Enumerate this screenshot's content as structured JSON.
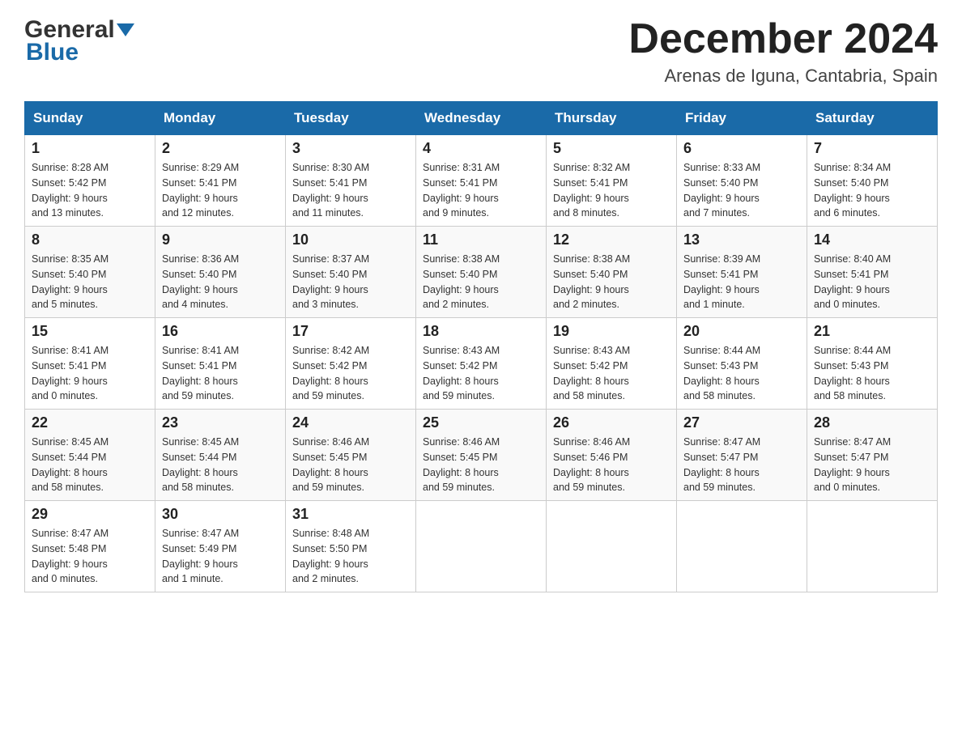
{
  "header": {
    "logo_general": "General",
    "logo_blue": "Blue",
    "month_title": "December 2024",
    "location": "Arenas de Iguna, Cantabria, Spain"
  },
  "days_of_week": [
    "Sunday",
    "Monday",
    "Tuesday",
    "Wednesday",
    "Thursday",
    "Friday",
    "Saturday"
  ],
  "weeks": [
    [
      {
        "day": "1",
        "sunrise": "8:28 AM",
        "sunset": "5:42 PM",
        "daylight": "9 hours and 13 minutes."
      },
      {
        "day": "2",
        "sunrise": "8:29 AM",
        "sunset": "5:41 PM",
        "daylight": "9 hours and 12 minutes."
      },
      {
        "day": "3",
        "sunrise": "8:30 AM",
        "sunset": "5:41 PM",
        "daylight": "9 hours and 11 minutes."
      },
      {
        "day": "4",
        "sunrise": "8:31 AM",
        "sunset": "5:41 PM",
        "daylight": "9 hours and 9 minutes."
      },
      {
        "day": "5",
        "sunrise": "8:32 AM",
        "sunset": "5:41 PM",
        "daylight": "9 hours and 8 minutes."
      },
      {
        "day": "6",
        "sunrise": "8:33 AM",
        "sunset": "5:40 PM",
        "daylight": "9 hours and 7 minutes."
      },
      {
        "day": "7",
        "sunrise": "8:34 AM",
        "sunset": "5:40 PM",
        "daylight": "9 hours and 6 minutes."
      }
    ],
    [
      {
        "day": "8",
        "sunrise": "8:35 AM",
        "sunset": "5:40 PM",
        "daylight": "9 hours and 5 minutes."
      },
      {
        "day": "9",
        "sunrise": "8:36 AM",
        "sunset": "5:40 PM",
        "daylight": "9 hours and 4 minutes."
      },
      {
        "day": "10",
        "sunrise": "8:37 AM",
        "sunset": "5:40 PM",
        "daylight": "9 hours and 3 minutes."
      },
      {
        "day": "11",
        "sunrise": "8:38 AM",
        "sunset": "5:40 PM",
        "daylight": "9 hours and 2 minutes."
      },
      {
        "day": "12",
        "sunrise": "8:38 AM",
        "sunset": "5:40 PM",
        "daylight": "9 hours and 2 minutes."
      },
      {
        "day": "13",
        "sunrise": "8:39 AM",
        "sunset": "5:41 PM",
        "daylight": "9 hours and 1 minute."
      },
      {
        "day": "14",
        "sunrise": "8:40 AM",
        "sunset": "5:41 PM",
        "daylight": "9 hours and 0 minutes."
      }
    ],
    [
      {
        "day": "15",
        "sunrise": "8:41 AM",
        "sunset": "5:41 PM",
        "daylight": "9 hours and 0 minutes."
      },
      {
        "day": "16",
        "sunrise": "8:41 AM",
        "sunset": "5:41 PM",
        "daylight": "8 hours and 59 minutes."
      },
      {
        "day": "17",
        "sunrise": "8:42 AM",
        "sunset": "5:42 PM",
        "daylight": "8 hours and 59 minutes."
      },
      {
        "day": "18",
        "sunrise": "8:43 AM",
        "sunset": "5:42 PM",
        "daylight": "8 hours and 59 minutes."
      },
      {
        "day": "19",
        "sunrise": "8:43 AM",
        "sunset": "5:42 PM",
        "daylight": "8 hours and 58 minutes."
      },
      {
        "day": "20",
        "sunrise": "8:44 AM",
        "sunset": "5:43 PM",
        "daylight": "8 hours and 58 minutes."
      },
      {
        "day": "21",
        "sunrise": "8:44 AM",
        "sunset": "5:43 PM",
        "daylight": "8 hours and 58 minutes."
      }
    ],
    [
      {
        "day": "22",
        "sunrise": "8:45 AM",
        "sunset": "5:44 PM",
        "daylight": "8 hours and 58 minutes."
      },
      {
        "day": "23",
        "sunrise": "8:45 AM",
        "sunset": "5:44 PM",
        "daylight": "8 hours and 58 minutes."
      },
      {
        "day": "24",
        "sunrise": "8:46 AM",
        "sunset": "5:45 PM",
        "daylight": "8 hours and 59 minutes."
      },
      {
        "day": "25",
        "sunrise": "8:46 AM",
        "sunset": "5:45 PM",
        "daylight": "8 hours and 59 minutes."
      },
      {
        "day": "26",
        "sunrise": "8:46 AM",
        "sunset": "5:46 PM",
        "daylight": "8 hours and 59 minutes."
      },
      {
        "day": "27",
        "sunrise": "8:47 AM",
        "sunset": "5:47 PM",
        "daylight": "8 hours and 59 minutes."
      },
      {
        "day": "28",
        "sunrise": "8:47 AM",
        "sunset": "5:47 PM",
        "daylight": "9 hours and 0 minutes."
      }
    ],
    [
      {
        "day": "29",
        "sunrise": "8:47 AM",
        "sunset": "5:48 PM",
        "daylight": "9 hours and 0 minutes."
      },
      {
        "day": "30",
        "sunrise": "8:47 AM",
        "sunset": "5:49 PM",
        "daylight": "9 hours and 1 minute."
      },
      {
        "day": "31",
        "sunrise": "8:48 AM",
        "sunset": "5:50 PM",
        "daylight": "9 hours and 2 minutes."
      },
      null,
      null,
      null,
      null
    ]
  ],
  "labels": {
    "sunrise": "Sunrise:",
    "sunset": "Sunset:",
    "daylight": "Daylight:"
  }
}
